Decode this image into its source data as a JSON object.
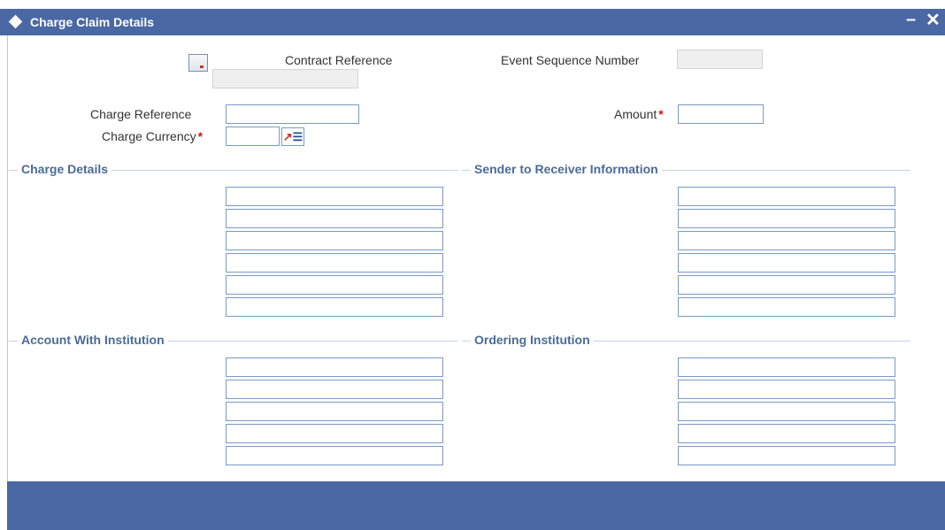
{
  "window": {
    "title": "Charge Claim Details",
    "minimize_glyph": "–",
    "close_glyph": "✕"
  },
  "header_fields": {
    "contract_reference_label": "Contract Reference",
    "contract_reference_value": "",
    "event_sequence_label": "Event Sequence Number",
    "event_sequence_value": "",
    "charge_reference_label": "Charge Reference",
    "charge_reference_value": "",
    "charge_currency_label": "Charge Currency",
    "charge_currency_value": "",
    "amount_label": "Amount",
    "amount_value": "",
    "required_marker": "*"
  },
  "sections": {
    "charge_details": "Charge Details",
    "sender_to_receiver": "Sender to Receiver Information",
    "account_with_institution": "Account With Institution",
    "ordering_institution": "Ordering Institution"
  },
  "icons": {
    "contract_lookup": "document-icon",
    "currency_lov": "list-of-values-icon",
    "title": "diamond-icon"
  },
  "colors": {
    "titlebar": "#4a68a4",
    "section_title": "#4a6b9a",
    "required": "#e01010",
    "input_border": "#7a9ac4"
  }
}
